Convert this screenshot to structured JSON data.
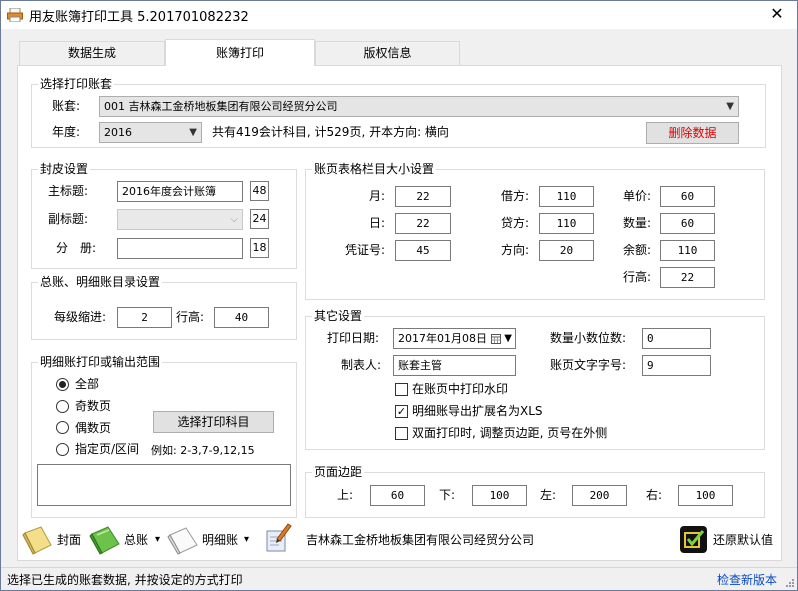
{
  "window": {
    "title": "用友账簿打印工具 5.201701082232",
    "close_glyph": "✕"
  },
  "tabs": [
    {
      "label": "数据生成",
      "active": false
    },
    {
      "label": "账簿打印",
      "active": true
    },
    {
      "label": "版权信息",
      "active": false
    }
  ],
  "select_account": {
    "title": "选择打印账套",
    "account_label": "账套:",
    "account_value": "001 吉林森工金桥地板集团有限公司经贸分公司",
    "year_label": "年度:",
    "year_value": "2016",
    "summary": "共有419会计科目, 计529页, 开本方向: 横向",
    "delete_button": "删除数据"
  },
  "cover": {
    "title": "封皮设置",
    "main_title_label": "主标题:",
    "main_title_value": "2016年度会计账簿",
    "main_title_size": "48",
    "sub_title_label": "副标题:",
    "sub_title_value": "",
    "sub_title_size": "24",
    "volume_label": "分　册:",
    "volume_value": "",
    "volume_size": "18"
  },
  "catalog": {
    "title": "总账、明细账目录设置",
    "indent_label": "每级缩进:",
    "indent_value": "2",
    "row_height_label": "行高:",
    "row_height_value": "40"
  },
  "range": {
    "title": "明细账打印或输出范围",
    "options": [
      {
        "label": "全部",
        "selected": true
      },
      {
        "label": "奇数页",
        "selected": false
      },
      {
        "label": "偶数页",
        "selected": false
      },
      {
        "label": "指定页/区间",
        "selected": false
      }
    ],
    "select_subject_button": "选择打印科目",
    "example": "例如: 2-3,7-9,12,15",
    "range_text": ""
  },
  "column_sizes": {
    "title": "账页表格栏目大小设置",
    "month_label": "月:",
    "month_value": "22",
    "day_label": "日:",
    "day_value": "22",
    "voucher_label": "凭证号:",
    "voucher_value": "45",
    "debit_label": "借方:",
    "debit_value": "110",
    "credit_label": "贷方:",
    "credit_value": "110",
    "direction_label": "方向:",
    "direction_value": "20",
    "unit_price_label": "单价:",
    "unit_price_value": "60",
    "quantity_label": "数量:",
    "quantity_value": "60",
    "balance_label": "余额:",
    "balance_value": "110",
    "row_height_label": "行高:",
    "row_height_value": "22"
  },
  "other": {
    "title": "其它设置",
    "print_date_label": "打印日期:",
    "print_date_value": "2017年01月08日",
    "decimals_label": "数量小数位数:",
    "decimals_value": "0",
    "maker_label": "制表人:",
    "maker_value": "账套主管",
    "font_size_label": "账页文字字号:",
    "font_size_value": "9",
    "checkboxes": [
      {
        "label": "在账页中打印水印",
        "checked": false
      },
      {
        "label": "明细账导出扩展名为XLS",
        "checked": true
      },
      {
        "label": "双面打印时, 调整页边距, 页号在外侧",
        "checked": false
      }
    ]
  },
  "margins": {
    "title": "页面边距",
    "top_label": "上:",
    "top_value": "60",
    "bottom_label": "下:",
    "bottom_value": "100",
    "left_label": "左:",
    "left_value": "200",
    "right_label": "右:",
    "right_value": "100"
  },
  "toolbar": {
    "cover_label": "封面",
    "ledger_label": "总账",
    "detail_label": "明细账",
    "company_name": "吉林森工金桥地板集团有限公司经贸分公司",
    "restore_label": "还原默认值",
    "dropdown_glyph": "▾"
  },
  "status": {
    "message": "选择已生成的账套数据, 并按设定的方式打印",
    "check_update": "检查新版本"
  },
  "colors": {
    "delete_text": "#e00000",
    "link": "#0a49c5",
    "border": "#dcdcdc"
  }
}
